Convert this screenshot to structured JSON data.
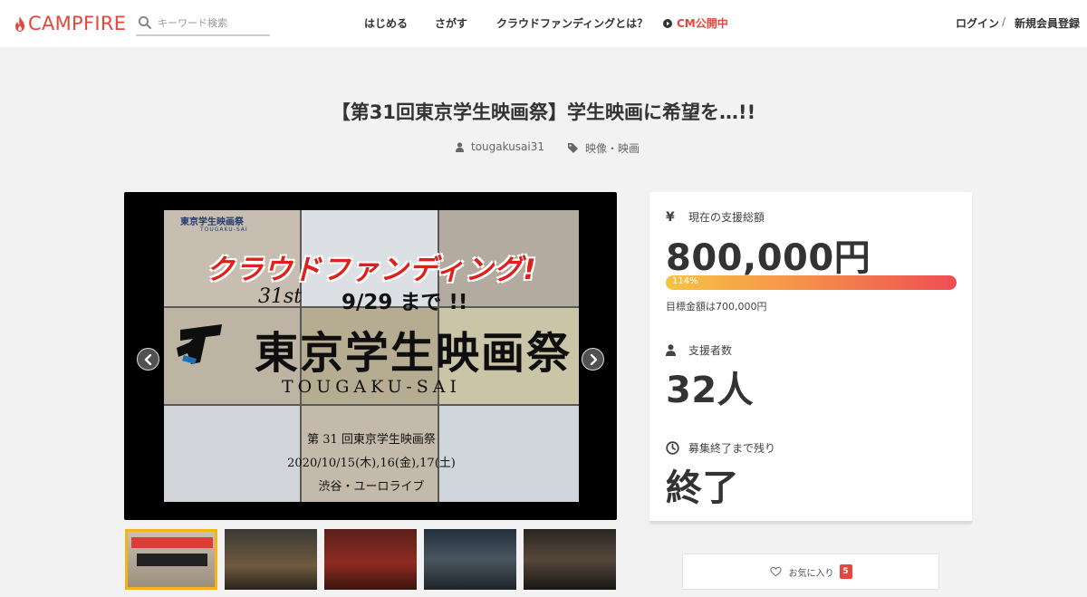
{
  "header": {
    "logo_text": "CAMPFIRE",
    "search_placeholder": "キーワード検索",
    "nav": [
      {
        "label": "はじめる"
      },
      {
        "label": "さがす"
      },
      {
        "label": "クラウドファンディングとは？"
      },
      {
        "label": "CM公開中"
      }
    ],
    "login": "ログイン",
    "separator": "/",
    "register": "新規会員登録"
  },
  "project": {
    "title": "【第31回東京学生映画祭】学生映画に希望を…!!",
    "owner": "tougakusai31",
    "category": "映像・映画"
  },
  "slide": {
    "crowdfunding": "クラウドファンディング!",
    "edition": "31st",
    "deadline": "9/29 まで !!",
    "festival_name": "東京学生映画祭",
    "festival_roman": "TOUGAKU-SAI",
    "event_name": "第 31 回東京学生映画祭",
    "event_dates": "2020/10/15(木),16(金),17(土)",
    "venue": "渋谷・ユーロライブ",
    "small_logo_text": "東京学生映画祭",
    "small_logo_roman": "TOUGAKU-SAI"
  },
  "stats": {
    "total_label": "現在の支援総額",
    "total_value": "800,000円",
    "progress_label": "114%",
    "progress_percent": 114,
    "goal_text": "目標金額は700,000円",
    "supporters_label": "支援者数",
    "supporters_value": "32人",
    "remaining_label": "募集終了まで残り",
    "remaining_value": "終了"
  },
  "favorite": {
    "label": "お気に入り",
    "count": "5"
  },
  "colors": {
    "brand": "#e8453c",
    "progress_start": "#f6c343",
    "progress_end": "#ee4d52",
    "active_thumb": "#f2b418"
  }
}
